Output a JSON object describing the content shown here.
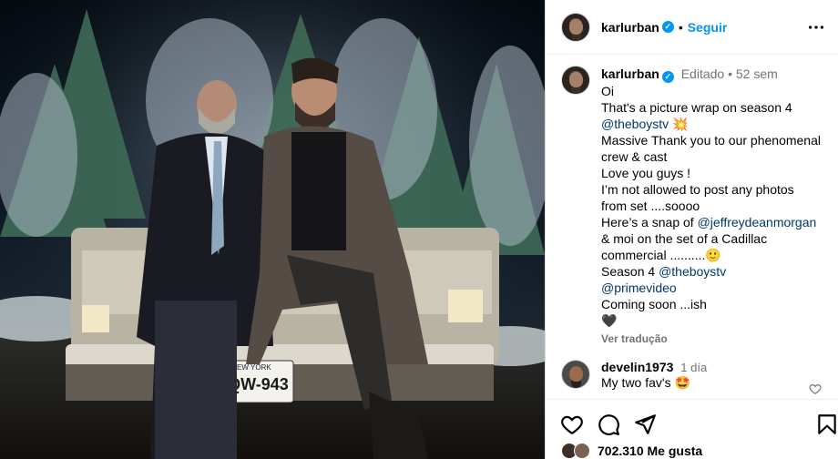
{
  "post": {
    "username": "karlurban",
    "follow_label": "Seguir",
    "separator": "•",
    "more_icon": "more-horizontal-icon",
    "photo": {
      "plate_top": "NEW YORK",
      "plate_number": "MQW-943"
    }
  },
  "caption": {
    "username": "karlurban",
    "edited_label": "Editado",
    "separator": "•",
    "time": "52 sem",
    "lines": [
      {
        "text": "Oi"
      },
      {
        "text": "That's a picture wrap on season 4"
      },
      {
        "mention": "@theboystv",
        "after": " 💥"
      },
      {
        "text": "Massive Thank you to our phenomenal"
      },
      {
        "text": "crew & cast"
      },
      {
        "text": "Love you guys !"
      },
      {
        "text": "I’m not allowed to post any photos"
      },
      {
        "text": "from set ....soooo"
      },
      {
        "before": "Here’s a snap of ",
        "mention": "@jeffreydeanmorgan"
      },
      {
        "text": "& moi on the set of a Cadillac"
      },
      {
        "text": "commercial ..........🙂"
      },
      {
        "before": "Season 4 ",
        "mention": "@theboystv"
      },
      {
        "mention": "@primevideo"
      },
      {
        "text": "Coming soon ...ish"
      },
      {
        "text": "🖤"
      }
    ],
    "see_translation": "Ver tradução"
  },
  "comment": {
    "username": "develin1973",
    "time": "1 día",
    "text": "My two fav's 🤩"
  },
  "actions": {
    "like_icon": "heart-icon",
    "comment_icon": "comment-icon",
    "share_icon": "share-icon",
    "save_icon": "bookmark-icon",
    "likes_text": "702.310 Me gusta"
  },
  "colors": {
    "accent": "#0095f6",
    "mention": "#00376b",
    "muted": "#737373"
  }
}
